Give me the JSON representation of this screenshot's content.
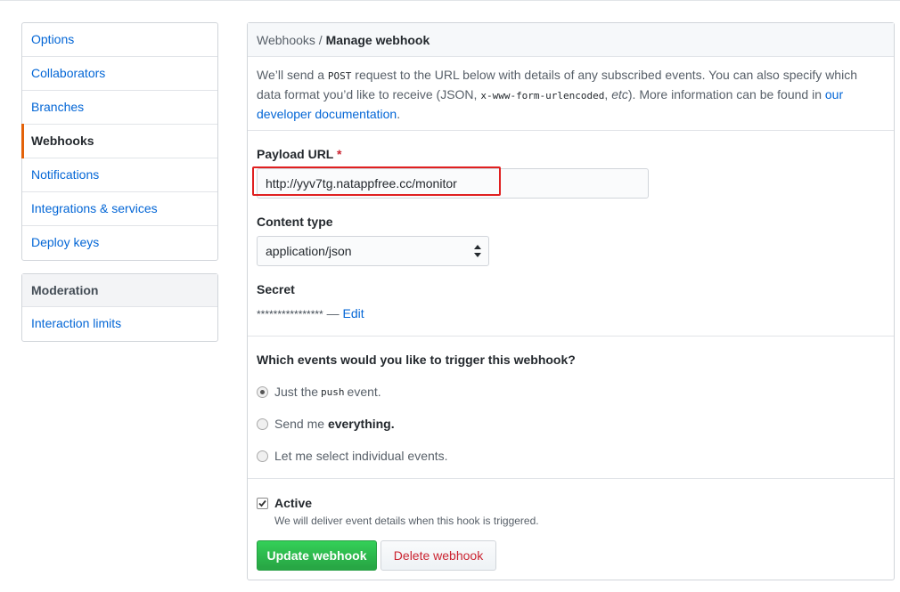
{
  "sidebar": {
    "items": [
      {
        "label": "Options"
      },
      {
        "label": "Collaborators"
      },
      {
        "label": "Branches"
      },
      {
        "label": "Webhooks"
      },
      {
        "label": "Notifications"
      },
      {
        "label": "Integrations & services"
      },
      {
        "label": "Deploy keys"
      }
    ],
    "selected": "Webhooks",
    "moderation": {
      "heading": "Moderation",
      "items": [
        {
          "label": "Interaction limits"
        }
      ]
    }
  },
  "header": {
    "crumb_parent": "Webhooks",
    "crumb_sep": " / ",
    "crumb_current": "Manage webhook"
  },
  "intro": {
    "part1": "We’ll send a ",
    "code1": "POST",
    "part2": " request to the URL below with details of any subscribed events. You can also specify which data format you’d like to receive (JSON, ",
    "code2": "x-www-form-urlencoded",
    "part3": ", ",
    "etc": "etc",
    "part4": "). More information can be found in ",
    "link": "our developer documentation",
    "part5": "."
  },
  "form": {
    "payload_label": "Payload URL",
    "required_mark": "*",
    "payload_value": "http://yyv7tg.natappfree.cc/monitor",
    "content_type_label": "Content type",
    "content_type_value": "application/json",
    "secret_label": "Secret",
    "secret_mask": "****************",
    "secret_dash": " — ",
    "secret_edit": "Edit"
  },
  "events": {
    "question": "Which events would you like to trigger this webhook?",
    "option1_pre": "Just the",
    "option1_code": "push",
    "option1_post": "event.",
    "option2_pre": "Send me ",
    "option2_bold": "everything.",
    "option3": "Let me select individual events.",
    "selected": "push"
  },
  "active": {
    "label": "Active",
    "checked": true,
    "note": "We will deliver event details when this hook is triggered."
  },
  "buttons": {
    "update": "Update webhook",
    "delete": "Delete webhook"
  },
  "colors": {
    "link": "#0366d6",
    "selected_accent": "#e36209",
    "primary_button": "#28a745",
    "danger_text": "#cb2431",
    "highlight_annotation": "#e02020"
  }
}
